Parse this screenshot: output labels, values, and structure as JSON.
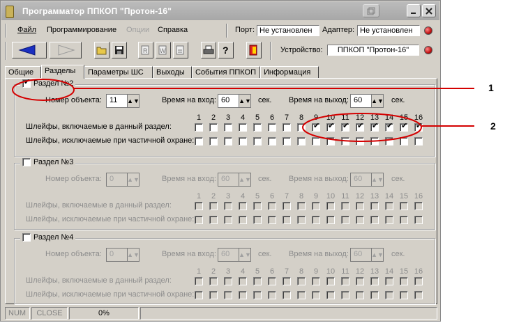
{
  "window": {
    "title": "Программатор ППКОП \"Протон-16\""
  },
  "menu": {
    "file": "Файл",
    "programming": "Программирование",
    "options": "Опции",
    "help": "Справка"
  },
  "port": {
    "label": "Порт:",
    "value": "Не установлен"
  },
  "adapter": {
    "label": "Адаптер:",
    "value": "Не установлен"
  },
  "device": {
    "label": "Устройство:",
    "value": "ППКОП \"Протон-16\""
  },
  "tabs": [
    "Общие",
    "Разделы",
    "Параметры ШС",
    "Выходы",
    "События ППКОП",
    "Информация"
  ],
  "active_tab": "Разделы",
  "labels": {
    "object_number": "Номер объекта:",
    "entry_time": "Время на вход:",
    "exit_time": "Время на выход:",
    "sec": "сек.",
    "included": "Шлейфы, включаемые в данный раздел:",
    "excluded": "Шлейфы, исключаемые при частичной охране:"
  },
  "loop_numbers": [
    "1",
    "2",
    "3",
    "4",
    "5",
    "6",
    "7",
    "8",
    "9",
    "10",
    "11",
    "12",
    "13",
    "14",
    "15",
    "16"
  ],
  "sections": [
    {
      "title": "Раздел №2",
      "enabled": true,
      "object_number": "11",
      "entry_time": "60",
      "exit_time": "60",
      "included": [
        9,
        10,
        11,
        12,
        13,
        14,
        15,
        16
      ],
      "excluded": []
    },
    {
      "title": "Раздел №3",
      "enabled": false,
      "object_number": "0",
      "entry_time": "60",
      "exit_time": "60",
      "included": [],
      "excluded": []
    },
    {
      "title": "Раздел №4",
      "enabled": false,
      "object_number": "0",
      "entry_time": "60",
      "exit_time": "60",
      "included": [],
      "excluded": []
    }
  ],
  "status": {
    "num": "NUM",
    "close": "CLOSE",
    "progress": "0%"
  },
  "annotations": {
    "one": "1",
    "two": "2"
  },
  "colors": {
    "highlight": "#d40000",
    "window_bg": "#d4d0c8"
  }
}
